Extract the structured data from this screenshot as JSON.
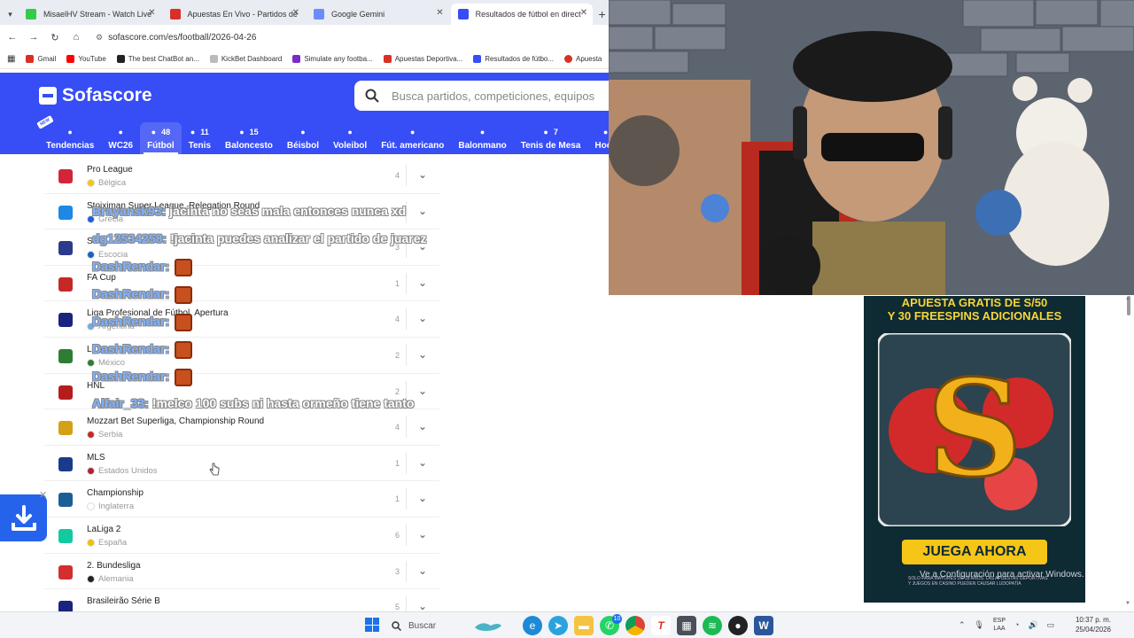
{
  "browser": {
    "tabs": [
      {
        "title": "MisaelHV Stream - Watch Live",
        "favicon_color": "#35c94a",
        "active": false
      },
      {
        "title": "Apuestas En Vivo - Partidos de",
        "favicon_color": "#d93025",
        "active": false
      },
      {
        "title": "Google Gemini",
        "favicon_color": "#6b8cff",
        "active": false
      },
      {
        "title": "Resultados de fútbol en direct",
        "favicon_color": "#374df5",
        "active": true
      }
    ],
    "new_tab": "+",
    "url": "sofascore.com/es/football/2026-04-26",
    "bookmarks": [
      {
        "label": "Gmail",
        "color": "#d93025"
      },
      {
        "label": "YouTube",
        "color": "#ff0000"
      },
      {
        "label": "The best ChatBot an...",
        "color": "#222222"
      },
      {
        "label": "KickBet Dashboard",
        "color": "#bbbbbb"
      },
      {
        "label": "Simulate any footba...",
        "color": "#7a2cc9"
      },
      {
        "label": "Apuestas Deportiva...",
        "color": "#d93025"
      },
      {
        "label": "Resultados de fútbo...",
        "color": "#374df5"
      },
      {
        "label": "Apuesta",
        "color": "#d93025"
      }
    ]
  },
  "sofascore": {
    "brand": "Sofascore",
    "search_placeholder": "Busca partidos, competiciones, equipos",
    "new_badge": "NEW",
    "sports": [
      {
        "label": "Tendencias",
        "count": "",
        "icon": "flame-icon",
        "active": false
      },
      {
        "label": "WC26",
        "count": "",
        "icon": "trophy-icon",
        "active": false
      },
      {
        "label": "Fútbol",
        "count": "48",
        "icon": "soccer-ball-icon",
        "active": true
      },
      {
        "label": "Tenis",
        "count": "11",
        "icon": "tennis-icon",
        "active": false
      },
      {
        "label": "Baloncesto",
        "count": "15",
        "icon": "basketball-icon",
        "active": false
      },
      {
        "label": "Béisbol",
        "count": "",
        "icon": "baseball-icon",
        "active": false
      },
      {
        "label": "Voleibol",
        "count": "",
        "icon": "volleyball-icon",
        "active": false
      },
      {
        "label": "Fút. americano",
        "count": "",
        "icon": "football-icon",
        "active": false
      },
      {
        "label": "Balonmano",
        "count": "",
        "icon": "handball-icon",
        "active": false
      },
      {
        "label": "Tenis de Mesa",
        "count": "7",
        "icon": "table-tennis-icon",
        "active": false
      },
      {
        "label": "Hock",
        "count": "",
        "icon": "hockey-icon",
        "active": false
      }
    ],
    "leagues": [
      {
        "name": "Pro League",
        "country": "Bélgica",
        "count": "4",
        "logo": "#d2253a",
        "flag": "#f5c518"
      },
      {
        "name": "Stoiximan Super League, Relegation Round",
        "country": "Grecia",
        "count": "",
        "logo": "#1e88e5",
        "flag": "#1e5fd6"
      },
      {
        "name": "S",
        "country": "Escocia",
        "count": "3",
        "logo": "#2b3a8c",
        "flag": "#1565c0"
      },
      {
        "name": "FA Cup",
        "country": "",
        "count": "1",
        "logo": "#c62828",
        "flag": "#ffffff"
      },
      {
        "name": "Liga Profesional de Fútbol, Apertura",
        "country": "Argentina",
        "count": "4",
        "logo": "#1a237e",
        "flag": "#74acdf"
      },
      {
        "name": "L",
        "country": "México",
        "count": "2",
        "logo": "#2e7d32",
        "flag": "#2e7d32"
      },
      {
        "name": "HNL",
        "country": "",
        "count": "2",
        "logo": "#b71c1c",
        "flag": "#d32f2f"
      },
      {
        "name": "Mozzart Bet Superliga, Championship Round",
        "country": "Serbia",
        "count": "4",
        "logo": "#d4a017",
        "flag": "#c62828"
      },
      {
        "name": "MLS",
        "country": "Estados Unidos",
        "count": "1",
        "logo": "#1a3a8a",
        "flag": "#b22234"
      },
      {
        "name": "Championship",
        "country": "Inglaterra",
        "count": "1",
        "logo": "#1b5e96",
        "flag": "#ffffff"
      },
      {
        "name": "LaLiga 2",
        "country": "España",
        "count": "6",
        "logo": "#14c8a0",
        "flag": "#f1bf00"
      },
      {
        "name": "2. Bundesliga",
        "country": "Alemania",
        "count": "3",
        "logo": "#d32f2f",
        "flag": "#222222"
      },
      {
        "name": "Brasileirão Série B",
        "country": "",
        "count": "5",
        "logo": "#1a237e",
        "flag": "#2e7d32"
      }
    ]
  },
  "chat": [
    {
      "user": "Brayansk93:",
      "message": "jacinta no seas mala entonces nunca xd"
    },
    {
      "user": "dg12534258:",
      "message": "!jacinta puedes analizar el partido de juarez"
    },
    {
      "user": "DashRendar:",
      "message": ""
    },
    {
      "user": "DashRendar:",
      "message": ""
    },
    {
      "user": "DashRendar:",
      "message": ""
    },
    {
      "user": "DashRendar:",
      "message": ""
    },
    {
      "user": "DashRendar:",
      "message": ""
    },
    {
      "user": "Alfair_33:",
      "message": "!melco 100 subs ni hasta ormeño tiene tanto"
    }
  ],
  "ad": {
    "headline_1": "APUESTA GRATIS DE S/50",
    "headline_2": "Y 30 FREESPINS ADICIONALES",
    "cta": "JUEGA AHORA",
    "footer": "SOLO PARA MAYORES DE 18 AÑOS. LAS APUESTAS DEPORTIVAS Y JUEGOS EN CASINO PUEDEN CAUSAR LUDOPATÍA",
    "windows_activation": "Ve a Configuración para activar Windows."
  },
  "taskbar": {
    "search_label": "Buscar",
    "whatsapp_badge": "10",
    "lang_line1": "ESP",
    "lang_line2": "LAA",
    "time": "10:37 p. m.",
    "date": "25/04/2026"
  }
}
